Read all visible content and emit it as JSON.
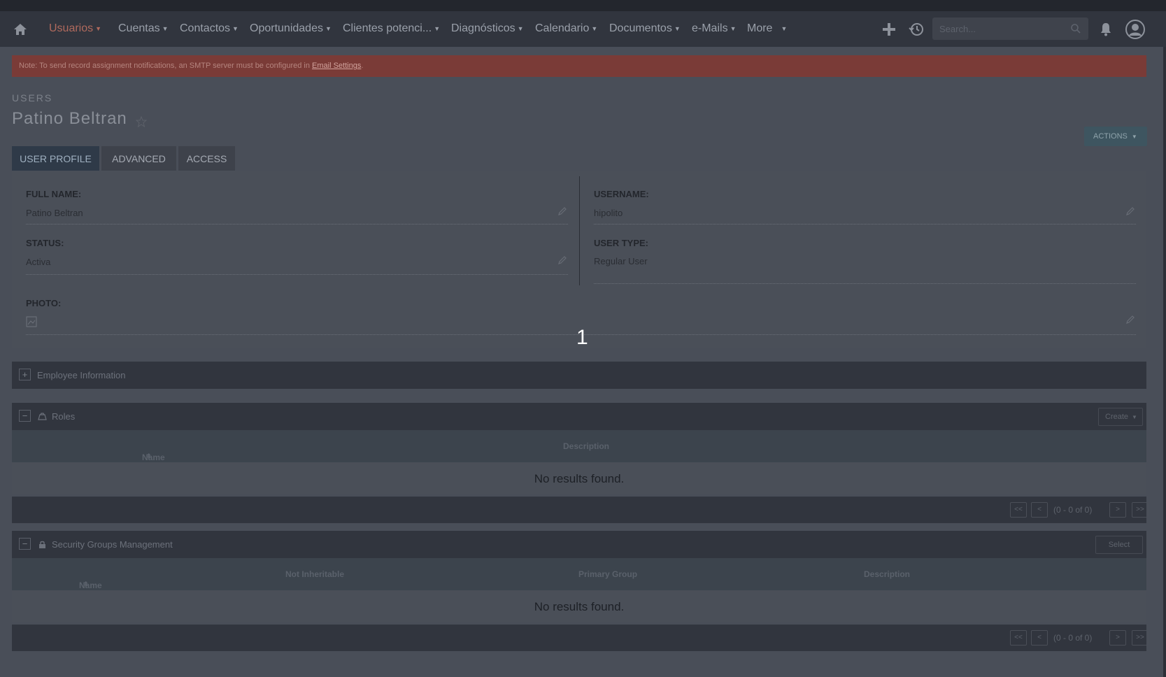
{
  "nav": {
    "items": [
      "Usuarios",
      "Cuentas",
      "Contactos",
      "Oportunidades",
      "Clientes potenci...",
      "Diagnósticos",
      "Calendario",
      "Documentos",
      "e-Mails",
      "More"
    ],
    "search_placeholder": "Search..."
  },
  "notice": {
    "text": "Note: To send record assignment notifications, an SMTP server must be configured in ",
    "link": "Email Settings",
    "tail": "."
  },
  "module_label": "USERS",
  "record_title": "Patino Beltran",
  "actions_label": "ACTIONS",
  "tabs": [
    "USER PROFILE",
    "ADVANCED",
    "ACCESS"
  ],
  "fields": {
    "full_name_label": "FULL NAME:",
    "full_name": "Patino Beltran",
    "username_label": "USERNAME:",
    "username": "hipolito",
    "status_label": "STATUS:",
    "status": "Activa",
    "user_type_label": "USER TYPE:",
    "user_type": "Regular User",
    "photo_label": "PHOTO:"
  },
  "overlay_number": "1",
  "employee_info": {
    "title": "Employee Information",
    "toggle": "+"
  },
  "roles": {
    "title": "Roles",
    "toggle": "−",
    "create_label": "Create",
    "columns": [
      "Name",
      "Description"
    ],
    "empty": "No results found.",
    "pager_info": "(0 - 0 of 0)"
  },
  "security_groups": {
    "title": "Security Groups Management",
    "toggle": "−",
    "select_label": "Select",
    "columns": [
      "Name",
      "Not Inheritable",
      "Primary Group",
      "Description"
    ],
    "empty": "No results found.",
    "pager_info": "(0 - 0 of 0)"
  },
  "pager_buttons": [
    "<<",
    "<",
    ">",
    ">>"
  ],
  "colors": {
    "navbar": "#31353e",
    "active_nav": "#b06a5d",
    "notice_bg": "#7a3b37",
    "active_tab": "#2f3a48"
  },
  "icons": [
    "home-icon",
    "plus-icon",
    "history-icon",
    "search-icon",
    "bell-icon",
    "user-avatar-icon",
    "star-icon",
    "pencil-icon",
    "broken-image-icon",
    "roles-icon",
    "lock-icon"
  ]
}
